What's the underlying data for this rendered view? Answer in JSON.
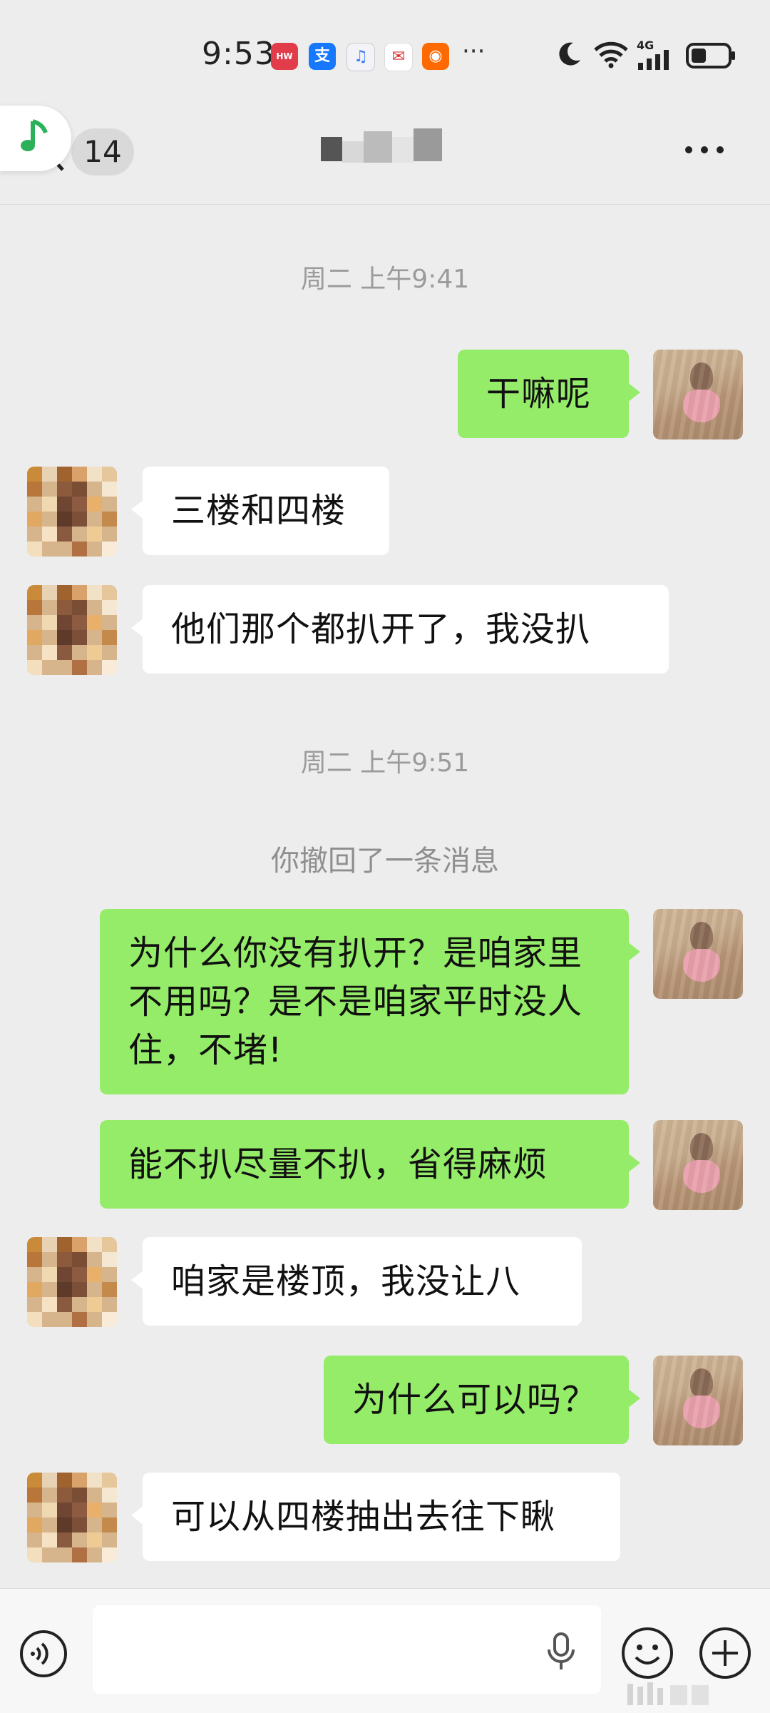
{
  "status_bar": {
    "time": "9:53",
    "overflow": "···",
    "network": "4G",
    "app_icons": [
      "huawei-store-icon",
      "alipay-icon",
      "music-app-icon",
      "mail-app-icon",
      "taobao-app-icon"
    ]
  },
  "header": {
    "unread_count": "14",
    "more_label": "···"
  },
  "colors": {
    "background": "#ededed",
    "my_bubble": "#95ec69",
    "their_bubble": "#ffffff",
    "timestamp_text": "#9b9b9b"
  },
  "messages": [
    {
      "type": "time",
      "text": "周二 上午9:41"
    },
    {
      "type": "msg",
      "from": "me",
      "text": "干嘛呢"
    },
    {
      "type": "msg",
      "from": "other",
      "text": "三楼和四楼"
    },
    {
      "type": "msg",
      "from": "other",
      "text": "他们那个都扒开了，我没扒"
    },
    {
      "type": "time",
      "text": "周二 上午9:51"
    },
    {
      "type": "system",
      "text": "你撤回了一条消息"
    },
    {
      "type": "msg",
      "from": "me",
      "text": "为什么你没有扒开？是咱家里不用吗？是不是咱家平时没人住，不堵!"
    },
    {
      "type": "msg",
      "from": "me",
      "text": "能不扒尽量不扒，省得麻烦"
    },
    {
      "type": "msg",
      "from": "other",
      "text": "咱家是楼顶，我没让八"
    },
    {
      "type": "msg",
      "from": "me",
      "text": "为什么可以吗？"
    },
    {
      "type": "msg",
      "from": "other",
      "text": "可以从四楼抽出去往下瞅"
    }
  ],
  "input": {
    "value": "",
    "placeholder": ""
  }
}
